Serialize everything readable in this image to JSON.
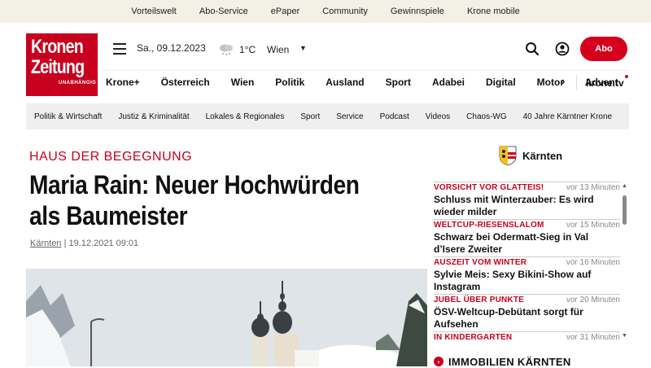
{
  "topbar": {
    "links": [
      "Vorteilswelt",
      "Abo-Service",
      "ePaper",
      "Community",
      "Gewinnspiele",
      "Krone mobile"
    ]
  },
  "logo": {
    "line1": "Kronen",
    "line2": "Zeitung",
    "tagline": "UNABHÄNGIG"
  },
  "header": {
    "date": "Sa., 09.12.2023",
    "temperature": "1°C",
    "city": "Wien",
    "abo_label": "Abo"
  },
  "mainnav": {
    "items": [
      "Krone+",
      "Österreich",
      "Wien",
      "Politik",
      "Ausland",
      "Sport",
      "Adabei",
      "Digital",
      "Motor",
      "Advent"
    ],
    "krone_tv": "krone.tv"
  },
  "subnav": {
    "items": [
      "Politik & Wirtschaft",
      "Justiz & Kriminalität",
      "Lokales & Regionales",
      "Sport",
      "Service",
      "Podcast",
      "Videos",
      "Chaos-WG",
      "40 Jahre Kärntner Krone"
    ]
  },
  "article": {
    "kicker": "HAUS DER BEGEGNUNG",
    "headline": "Maria Rain: Neuer Hochwürden als Baumeister",
    "category": "Kärnten",
    "date": "19.12.2021 09:01"
  },
  "sidebar": {
    "region": "Kärnten",
    "ticker": [
      {
        "kicker": "VORSICHT VOR GLATTEIS!",
        "time": "vor 13 Minuten",
        "title": "Schluss mit Winterzauber: Es wird wieder milder"
      },
      {
        "kicker": "WELTCUP-RIESENSLALOM",
        "time": "vor 15 Minuten",
        "title": "Schwarz bei Odermatt-Sieg in Val d’Isere Zweiter"
      },
      {
        "kicker": "AUSZEIT VOM WINTER",
        "time": "vor 16 Minuten",
        "title": "Sylvie Meis: Sexy Bikini-Show auf Instagram"
      },
      {
        "kicker": "JUBEL ÜBER PUNKTE",
        "time": "vor 20 Minuten",
        "title": "ÖSV-Weltcup-Debütant sorgt für Aufsehen"
      },
      {
        "kicker": "IN KINDERGARTEN",
        "time": "vor 31 Minuten",
        "title": ""
      }
    ],
    "immo_label": "IMMOBILIEN KÄRNTEN"
  },
  "colors": {
    "brand_red": "#c8001e",
    "topbar_bg": "#f3f1e5",
    "subnav_bg": "#efefef"
  }
}
